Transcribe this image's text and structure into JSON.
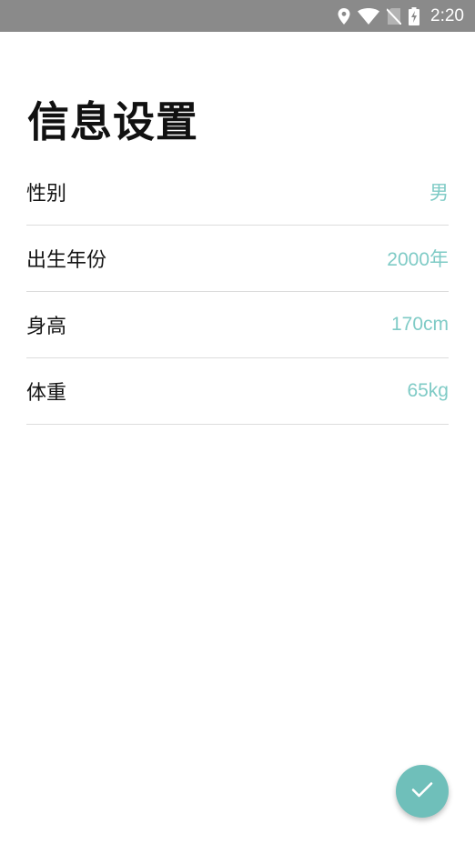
{
  "status_bar": {
    "time": "2:20",
    "icons": [
      "location-icon",
      "wifi-icon",
      "no-sim-icon",
      "battery-charging-icon"
    ]
  },
  "page": {
    "title": "信息设置"
  },
  "settings": [
    {
      "label": "性别",
      "value": "男"
    },
    {
      "label": "出生年份",
      "value": "2000年"
    },
    {
      "label": "身高",
      "value": "170cm"
    },
    {
      "label": "体重",
      "value": "65kg"
    }
  ],
  "fab": {
    "icon": "checkmark-icon"
  },
  "colors": {
    "accent": "#6fbfba",
    "value_text": "#7fcbc6",
    "status_bar": "#8a8a8a"
  }
}
